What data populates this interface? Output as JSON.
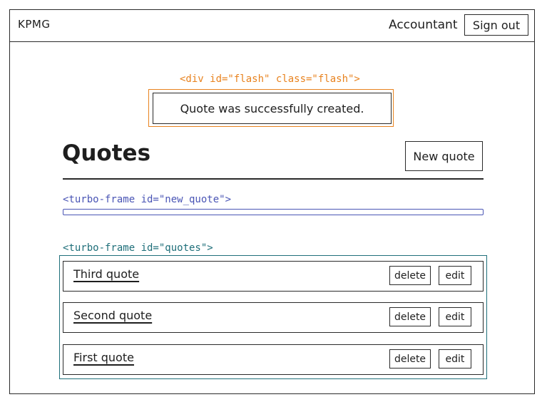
{
  "navbar": {
    "brand": "KPMG",
    "role": "Accountant",
    "sign_out_label": "Sign out"
  },
  "annotations": {
    "flash": "<div id=\"flash\" class=\"flash\">",
    "new_quote_frame": "<turbo-frame id=\"new_quote\">",
    "quotes_frame": "<turbo-frame id=\"quotes\">"
  },
  "flash": {
    "message": "Quote was successfully created."
  },
  "main": {
    "title": "Quotes",
    "new_quote_label": "New quote"
  },
  "quotes": [
    {
      "name": "Third quote",
      "delete_label": "delete",
      "edit_label": "edit"
    },
    {
      "name": "Second quote",
      "delete_label": "delete",
      "edit_label": "edit"
    },
    {
      "name": "First quote",
      "delete_label": "delete",
      "edit_label": "edit"
    }
  ],
  "colors": {
    "flash_annotation": "#e8821e",
    "new_quote_frame": "#4a55b5",
    "quotes_frame": "#1f6f7a",
    "ink": "#2a2a2a"
  }
}
